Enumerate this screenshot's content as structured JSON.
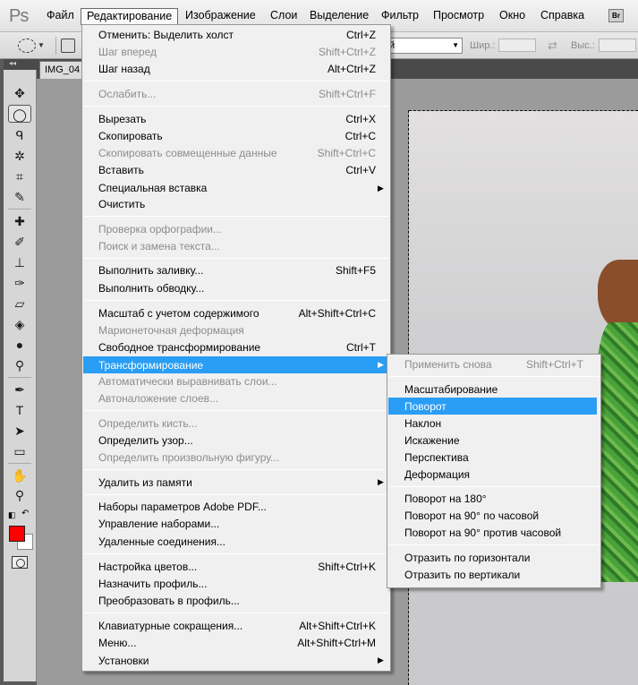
{
  "app": {
    "logo": "Ps",
    "bridge_button": "Br"
  },
  "menubar": {
    "items": [
      "Файл",
      "Редактирование",
      "Изображение",
      "Слои",
      "Выделение",
      "Фильтр",
      "Просмотр",
      "Окно",
      "Справка"
    ],
    "active_index": 1
  },
  "options_bar": {
    "style_value": "ный",
    "width_label": "Шир.:",
    "height_label": "Выс.:"
  },
  "document": {
    "tab_title": "IMG_04"
  },
  "edit_menu": {
    "items": [
      {
        "label": "Отменить: Выделить холст",
        "shortcut": "Ctrl+Z",
        "enabled": true
      },
      {
        "label": "Шаг вперед",
        "shortcut": "Shift+Ctrl+Z",
        "enabled": false
      },
      {
        "label": "Шаг назад",
        "shortcut": "Alt+Ctrl+Z",
        "enabled": true
      },
      {
        "label": "Ослабить...",
        "shortcut": "Shift+Ctrl+F",
        "enabled": false
      },
      {
        "label": "Вырезать",
        "shortcut": "Ctrl+X",
        "enabled": true
      },
      {
        "label": "Скопировать",
        "shortcut": "Ctrl+C",
        "enabled": true
      },
      {
        "label": "Скопировать совмещенные данные",
        "shortcut": "Shift+Ctrl+C",
        "enabled": false
      },
      {
        "label": "Вставить",
        "shortcut": "Ctrl+V",
        "enabled": true
      },
      {
        "label": "Специальная вставка",
        "shortcut": "",
        "enabled": true,
        "submenu": true
      },
      {
        "label": "Очистить",
        "shortcut": "",
        "enabled": true
      },
      {
        "label": "Проверка орфографии...",
        "shortcut": "",
        "enabled": false
      },
      {
        "label": "Поиск и замена текста...",
        "shortcut": "",
        "enabled": false
      },
      {
        "label": "Выполнить заливку...",
        "shortcut": "Shift+F5",
        "enabled": true
      },
      {
        "label": "Выполнить обводку...",
        "shortcut": "",
        "enabled": true
      },
      {
        "label": "Масштаб с учетом содержимого",
        "shortcut": "Alt+Shift+Ctrl+C",
        "enabled": true
      },
      {
        "label": "Марионеточная деформация",
        "shortcut": "",
        "enabled": false
      },
      {
        "label": "Свободное трансформирование",
        "shortcut": "Ctrl+T",
        "enabled": true
      },
      {
        "label": "Трансформирование",
        "shortcut": "",
        "enabled": true,
        "submenu": true,
        "highlighted": true
      },
      {
        "label": "Автоматически выравнивать слои...",
        "shortcut": "",
        "enabled": false
      },
      {
        "label": "Автоналожение слоев...",
        "shortcut": "",
        "enabled": false
      },
      {
        "label": "Определить кисть...",
        "shortcut": "",
        "enabled": false
      },
      {
        "label": "Определить узор...",
        "shortcut": "",
        "enabled": true
      },
      {
        "label": "Определить произвольную фигуру...",
        "shortcut": "",
        "enabled": false
      },
      {
        "label": "Удалить из памяти",
        "shortcut": "",
        "enabled": true,
        "submenu": true
      },
      {
        "label": "Наборы параметров Adobe PDF...",
        "shortcut": "",
        "enabled": true
      },
      {
        "label": "Управление наборами...",
        "shortcut": "",
        "enabled": true
      },
      {
        "label": "Удаленные соединения...",
        "shortcut": "",
        "enabled": true
      },
      {
        "label": "Настройка цветов...",
        "shortcut": "Shift+Ctrl+K",
        "enabled": true
      },
      {
        "label": "Назначить профиль...",
        "shortcut": "",
        "enabled": true
      },
      {
        "label": "Преобразовать в профиль...",
        "shortcut": "",
        "enabled": true
      },
      {
        "label": "Клавиатурные сокращения...",
        "shortcut": "Alt+Shift+Ctrl+K",
        "enabled": true
      },
      {
        "label": "Меню...",
        "shortcut": "Alt+Shift+Ctrl+M",
        "enabled": true
      },
      {
        "label": "Установки",
        "shortcut": "",
        "enabled": true,
        "submenu": true
      }
    ]
  },
  "transform_submenu": {
    "items": [
      {
        "label": "Применить снова",
        "shortcut": "Shift+Ctrl+T",
        "enabled": false
      },
      {
        "label": "Масштабирование",
        "enabled": true
      },
      {
        "label": "Поворот",
        "enabled": true,
        "highlighted": true
      },
      {
        "label": "Наклон",
        "enabled": true
      },
      {
        "label": "Искажение",
        "enabled": true
      },
      {
        "label": "Перспектива",
        "enabled": true
      },
      {
        "label": "Деформация",
        "enabled": true
      },
      {
        "label": "Поворот на 180°",
        "enabled": true
      },
      {
        "label": "Поворот на 90° по часовой",
        "enabled": true
      },
      {
        "label": "Поворот на 90° против часовой",
        "enabled": true
      },
      {
        "label": "Отразить по горизонтали",
        "enabled": true
      },
      {
        "label": "Отразить по вертикали",
        "enabled": true
      }
    ]
  },
  "colors": {
    "foreground": "#ff0000",
    "background": "#ffffff",
    "highlight": "#2a9df4"
  },
  "tools": [
    "move-icon",
    "elliptical-marquee-icon",
    "lasso-icon",
    "quick-selection-icon",
    "crop-icon",
    "eyedropper-icon",
    "healing-brush-icon",
    "brush-icon",
    "clone-stamp-icon",
    "history-brush-icon",
    "eraser-icon",
    "paint-bucket-icon",
    "blur-icon",
    "dodge-icon",
    "pen-icon",
    "type-icon",
    "path-selection-icon",
    "rectangle-icon",
    "hand-icon",
    "zoom-icon"
  ]
}
